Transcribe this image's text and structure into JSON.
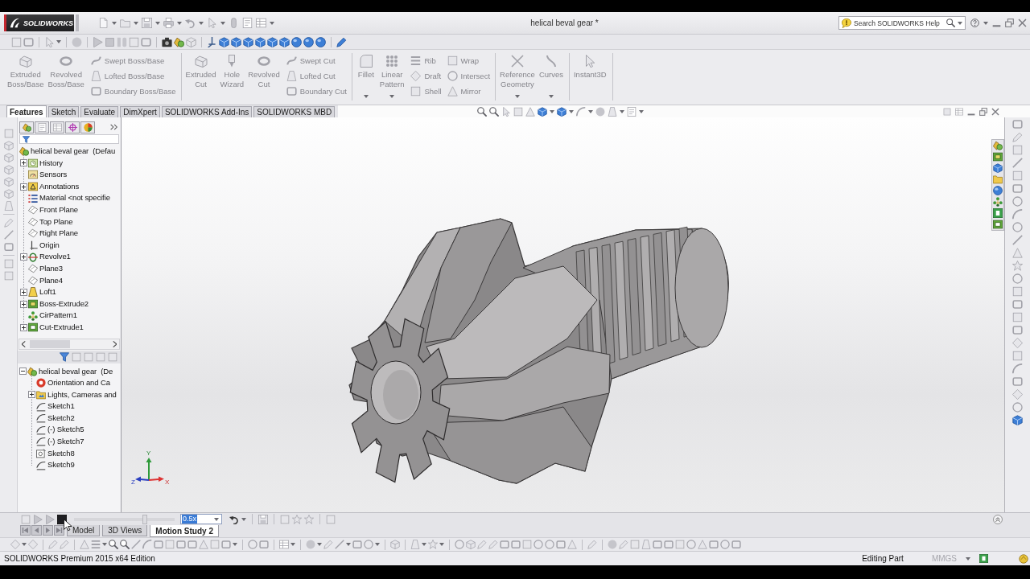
{
  "window": {
    "logo": "SOLIDWORKS",
    "title": "helical beval gear *"
  },
  "search": {
    "placeholder": "Search SOLIDWORKS Help"
  },
  "ribbon": {
    "groups": [
      {
        "large": [
          {
            "label": "Extruded Boss/Base",
            "dropdown": false
          },
          {
            "label": "Revolved Boss/Base",
            "dropdown": false
          }
        ],
        "small_columns": [
          [
            "Swept Boss/Base",
            "Lofted Boss/Base",
            "Boundary Boss/Base"
          ]
        ]
      },
      {
        "large": [
          {
            "label": "Extruded Cut",
            "dropdown": false
          },
          {
            "label": "Hole Wizard",
            "dropdown": false
          },
          {
            "label": "Revolved Cut",
            "dropdown": false
          }
        ],
        "small_columns": [
          [
            "Swept Cut",
            "Lofted Cut",
            "Boundary Cut"
          ]
        ]
      },
      {
        "large": [
          {
            "label": "Fillet",
            "dropdown": true
          },
          {
            "label": "Linear Pattern",
            "dropdown": true
          }
        ],
        "small_columns": [
          [
            "Rib",
            "Draft",
            "Shell"
          ],
          [
            "Wrap",
            "Intersect",
            "Mirror"
          ]
        ]
      },
      {
        "large": [
          {
            "label": "Reference Geometry",
            "dropdown": true
          },
          {
            "label": "Curves",
            "dropdown": true
          }
        ]
      },
      {
        "large": [
          {
            "label": "Instant3D",
            "dropdown": false
          }
        ]
      }
    ]
  },
  "tabs": [
    {
      "label": "Features",
      "selected": true
    },
    {
      "label": "Sketch",
      "selected": false
    },
    {
      "label": "Evaluate",
      "selected": false
    },
    {
      "label": "DimXpert",
      "selected": false
    },
    {
      "label": "SOLIDWORKS Add-Ins",
      "selected": false
    },
    {
      "label": "SOLIDWORKS MBD",
      "selected": false
    }
  ],
  "feature_tree": {
    "root": {
      "label": "helical beval gear  (Defau",
      "kind": "part",
      "expandable": false,
      "children": [
        {
          "label": "History",
          "kind": "history",
          "expandable": true,
          "expanded": false
        },
        {
          "label": "Sensors",
          "kind": "sensors",
          "expandable": false
        },
        {
          "label": "Annotations",
          "kind": "annotations",
          "expandable": true,
          "expanded": false
        },
        {
          "label": "Material <not specifie",
          "kind": "material",
          "expandable": false
        },
        {
          "label": "Front Plane",
          "kind": "plane",
          "expandable": false
        },
        {
          "label": "Top Plane",
          "kind": "plane",
          "expandable": false
        },
        {
          "label": "Right Plane",
          "kind": "plane",
          "expandable": false
        },
        {
          "label": "Origin",
          "kind": "origin",
          "expandable": false
        },
        {
          "label": "Revolve1",
          "kind": "revolve",
          "expandable": true,
          "expanded": false
        },
        {
          "label": "Plane3",
          "kind": "plane",
          "expandable": false
        },
        {
          "label": "Plane4",
          "kind": "plane",
          "expandable": false
        },
        {
          "label": "Loft1",
          "kind": "loft",
          "expandable": true,
          "expanded": false
        },
        {
          "label": "Boss-Extrude2",
          "kind": "extrude",
          "expandable": true,
          "expanded": false
        },
        {
          "label": "CirPattern1",
          "kind": "pattern",
          "expandable": false
        },
        {
          "label": "Cut-Extrude1",
          "kind": "cut",
          "expandable": true,
          "expanded": false
        }
      ]
    }
  },
  "motion_tree": {
    "root": {
      "label": "helical beval gear  (De",
      "kind": "part",
      "expandable": true,
      "expanded": true,
      "children": [
        {
          "label": "Orientation and Ca",
          "kind": "orientation",
          "expandable": false
        },
        {
          "label": "Lights, Cameras and",
          "kind": "lights",
          "expandable": true,
          "expanded": false
        },
        {
          "label": "Sketch1",
          "kind": "sketch",
          "expandable": false
        },
        {
          "label": "Sketch2",
          "kind": "sketch",
          "expandable": false
        },
        {
          "label": "(-) Sketch5",
          "kind": "sketch",
          "expandable": false
        },
        {
          "label": "(-) Sketch7",
          "kind": "sketch",
          "expandable": false
        },
        {
          "label": "Sketch8",
          "kind": "sketch_frame",
          "expandable": false
        },
        {
          "label": "Sketch9",
          "kind": "sketch",
          "expandable": false
        }
      ]
    }
  },
  "triad": {
    "y": "Y",
    "z": "Z",
    "x": "X"
  },
  "motion_bar": {
    "timeline": {
      "level": 0.7
    },
    "speed": {
      "value": "0.5x",
      "highlighted": true
    }
  },
  "bottom_tabs": [
    {
      "label": "Model",
      "selected": false
    },
    {
      "label": "3D Views",
      "selected": false
    },
    {
      "label": "Motion Study 2",
      "selected": true
    }
  ],
  "status_bar": {
    "product": "SOLIDWORKS Premium 2015 x64 Edition",
    "mode": "Editing Part",
    "units": "MMGS",
    "units_disabled": true
  }
}
